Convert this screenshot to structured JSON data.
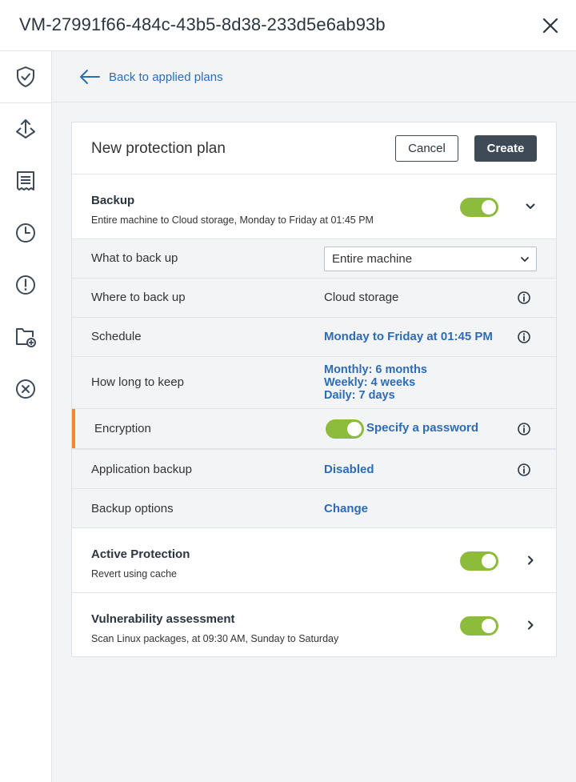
{
  "window": {
    "title": "VM-27991f66-484c-43b5-8d38-233d5e6ab93b"
  },
  "sidebar": {
    "items": [
      {
        "icon": "shield-check-icon",
        "active": true
      },
      {
        "icon": "recovery-icon"
      },
      {
        "icon": "activities-icon"
      },
      {
        "icon": "history-icon"
      },
      {
        "icon": "alert-icon"
      },
      {
        "icon": "add-folder-icon"
      },
      {
        "icon": "remove-icon"
      }
    ]
  },
  "nav": {
    "back_label": "Back to applied plans"
  },
  "plan": {
    "title": "New protection plan",
    "cancel_label": "Cancel",
    "create_label": "Create",
    "backup": {
      "title": "Backup",
      "subtitle": "Entire machine to Cloud storage, Monday to Friday at 01:45 PM",
      "enabled": true,
      "rows": {
        "what": {
          "label": "What to back up",
          "value": "Entire machine"
        },
        "where": {
          "label": "Where to back up",
          "value": "Cloud storage"
        },
        "schedule": {
          "label": "Schedule",
          "value": "Monday to Friday at 01:45 PM"
        },
        "keep": {
          "label": "How long to keep",
          "monthly": "Monthly: 6 months",
          "weekly": "Weekly: 4 weeks",
          "daily": "Daily: 7 days"
        },
        "encryption": {
          "label": "Encryption",
          "enabled": true,
          "value": "Specify a password"
        },
        "app_backup": {
          "label": "Application backup",
          "value": "Disabled"
        },
        "options": {
          "label": "Backup options",
          "value": "Change"
        }
      }
    },
    "active_protection": {
      "title": "Active Protection",
      "subtitle": "Revert using cache",
      "enabled": true
    },
    "vulnerability": {
      "title": "Vulnerability assessment",
      "subtitle": "Scan Linux packages, at 09:30 AM, Sunday to Saturday",
      "enabled": true
    }
  },
  "colors": {
    "accent": "#2d6cb5",
    "toggle_on": "#8dbb3c",
    "warning_accent": "#f08a24",
    "primary_button": "#3e4b57"
  }
}
